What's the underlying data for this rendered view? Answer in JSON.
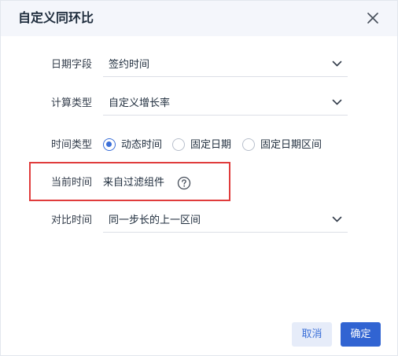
{
  "dialog": {
    "title": "自定义同环比",
    "close_icon": "close-icon"
  },
  "form": {
    "date_field": {
      "label": "日期字段",
      "value": "签约时间"
    },
    "calc_type": {
      "label": "计算类型",
      "value": "自定义增长率"
    },
    "time_type": {
      "label": "时间类型",
      "options": [
        {
          "label": "动态时间",
          "checked": true
        },
        {
          "label": "固定日期",
          "checked": false
        },
        {
          "label": "固定日期区间",
          "checked": false
        }
      ]
    },
    "current_time": {
      "label": "当前时间",
      "value": "来自过滤组件",
      "help_icon": "question-circle-icon"
    },
    "compare_time": {
      "label": "对比时间",
      "value": "同一步长的上一区间"
    }
  },
  "footer": {
    "cancel_label": "取消",
    "ok_label": "确定"
  },
  "colors": {
    "accent": "#3164d2",
    "highlight": "#e03c3c",
    "header_bg": "#f4f6fb"
  }
}
